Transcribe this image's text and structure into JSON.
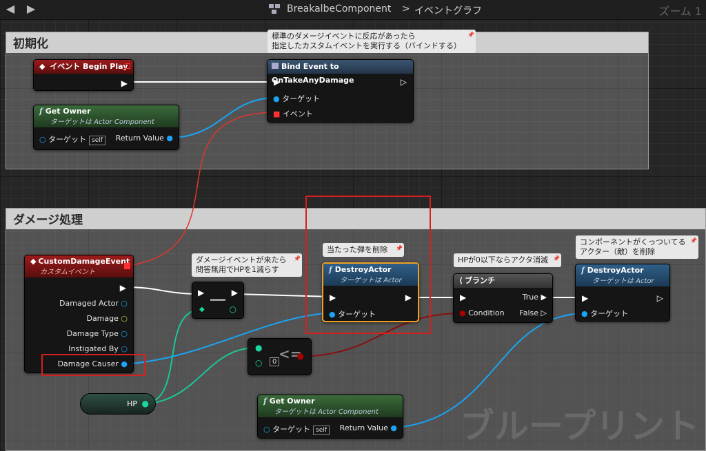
{
  "toolbar": {
    "breadcrumb_component": "BreakalbeComponent",
    "breadcrumb_sep": ">",
    "breadcrumb_graph": "イベントグラフ",
    "zoom": "ズーム 1"
  },
  "comments": {
    "init": "初期化",
    "damage": "ダメージ処理",
    "bind_note_1": "標準のダメージイベントに反応があったら",
    "bind_note_2": "指定したカスタムイベントを実行する（バインドする）",
    "hit_note": "当たった弾を削除",
    "decrement_note_1": "ダメージイベントが来たら",
    "decrement_note_2": "問答無用でHPを1減らす",
    "hp_note": "HPが0以下ならアクタ消滅",
    "component_note_1": "コンポーネントがくっついてる",
    "component_note_2": "アクター（敵）を削除"
  },
  "nodes": {
    "begin_play": {
      "title": "イベント Begin Play"
    },
    "get_owner_1": {
      "title": "Get Owner",
      "subtitle": "ターゲットは Actor Component",
      "target": "ターゲット",
      "self": "self",
      "return": "Return Value"
    },
    "bind_event": {
      "title": "Bind Event to OnTakeAnyDamage",
      "target": "ターゲット",
      "event": "イベント"
    },
    "custom_event": {
      "title": "CustomDamageEvent",
      "subtitle": "カスタムイベント",
      "pins": [
        "Damaged Actor",
        "Damage",
        "Damage Type",
        "Instigated By",
        "Damage Causer"
      ]
    },
    "destroy_1": {
      "title": "DestroyActor",
      "subtitle": "ターゲットは Actor",
      "target": "ターゲット"
    },
    "branch": {
      "title": "ブランチ",
      "true": "True",
      "condition": "Condition",
      "false": "False"
    },
    "destroy_2": {
      "title": "DestroyActor",
      "subtitle": "ターゲットは Actor",
      "target": "ターゲット"
    },
    "hp_var": {
      "label": "HP"
    },
    "compare": {
      "value": "0"
    },
    "get_owner_2": {
      "title": "Get Owner",
      "subtitle": "ターゲットは Actor Component",
      "target": "ターゲット",
      "self": "self",
      "return": "Return Value"
    }
  },
  "watermark": "ブループリント",
  "colors": {
    "exec": "#ffffff",
    "object": "#0ea5ff",
    "delegate": "#ff3838",
    "int": "#1bd6a0",
    "bool": "#8a0000",
    "float": "#a6e22e"
  }
}
